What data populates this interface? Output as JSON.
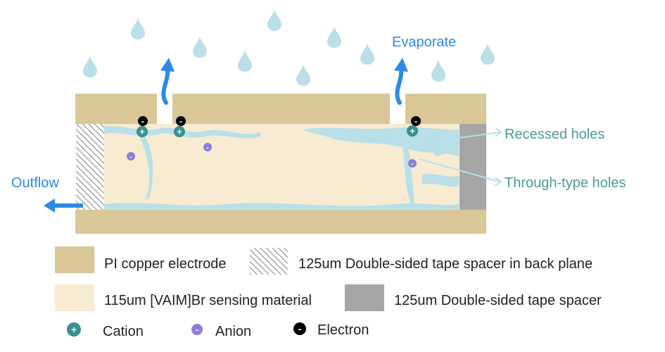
{
  "labels": {
    "evaporate": "Evaporate",
    "outflow": "Outflow",
    "recessed_holes": "Recessed holes",
    "through_type_holes": "Through-type holes"
  },
  "legend": {
    "electrode": "PI copper electrode",
    "back_spacer": "125um Double-sided tape spacer in back plane",
    "sensing_material": "115um [VAIM]Br sensing material",
    "spacer": "125um Double-sided tape spacer",
    "cation": "Cation",
    "anion": "Anion",
    "electron": "Electron"
  },
  "symbols": {
    "cation": "+",
    "anion": "-",
    "electron": "-"
  },
  "colors": {
    "electrode": "#d9c797",
    "sensing_material": "#f7ebd2",
    "spacer": "#a6a6a6",
    "water": "#b9dfe8",
    "cation": "#3a8f8f",
    "anion": "#8a7fd8",
    "electron": "#000000",
    "arrow": "#2e8ae6",
    "hole_label": "#4b9a9a",
    "outflow_label": "#2e8ae6"
  }
}
